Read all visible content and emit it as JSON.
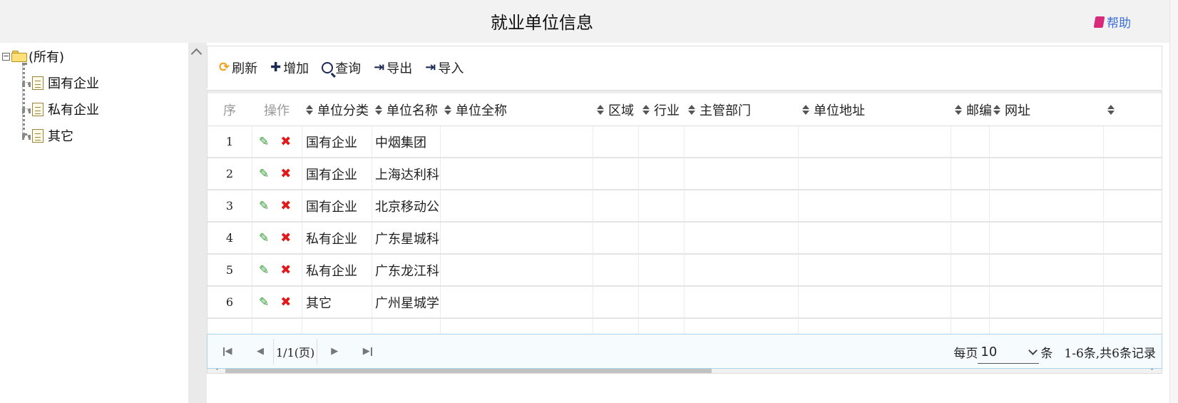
{
  "header": {
    "title": "就业单位信息",
    "help_label": "帮助",
    "help_icon": "book-icon",
    "help_color": "#3a6fd8"
  },
  "tree": {
    "root_label": "(所有)",
    "items": [
      {
        "label": "国有企业"
      },
      {
        "label": "私有企业"
      },
      {
        "label": "其它"
      }
    ]
  },
  "toolbar": {
    "refresh_label": "刷新",
    "add_label": "增加",
    "search_label": "查询",
    "export_label": "导出",
    "import_label": "导入"
  },
  "grid": {
    "columns": {
      "seq": "序",
      "actions": "操作",
      "category": "单位分类",
      "short_name": "单位名称",
      "full_name": "单位全称",
      "region": "区域",
      "industry": "行业",
      "department": "主管部门",
      "address": "单位地址",
      "postcode": "邮编",
      "website": "网址"
    },
    "rows": [
      {
        "seq": "1",
        "category": "国有企业",
        "short_name": "中烟集团"
      },
      {
        "seq": "2",
        "category": "国有企业",
        "short_name": "上海达利科技"
      },
      {
        "seq": "3",
        "category": "国有企业",
        "short_name": "北京移动公司"
      },
      {
        "seq": "4",
        "category": "私有企业",
        "short_name": "广东星城科技"
      },
      {
        "seq": "5",
        "category": "私有企业",
        "short_name": "广东龙江科技"
      },
      {
        "seq": "6",
        "category": "其它",
        "short_name": "广州星城学院"
      }
    ]
  },
  "pager": {
    "page_info": "1/1(页)",
    "per_page_prefix": "每页",
    "per_page_value": "10",
    "per_page_suffix": "条",
    "summary": "1-6条,共6条记录"
  },
  "colors": {
    "accent": "#f0a01e",
    "edit": "#2f9a2f",
    "delete": "#e01a1a",
    "pager_border": "#a9d4ec"
  }
}
